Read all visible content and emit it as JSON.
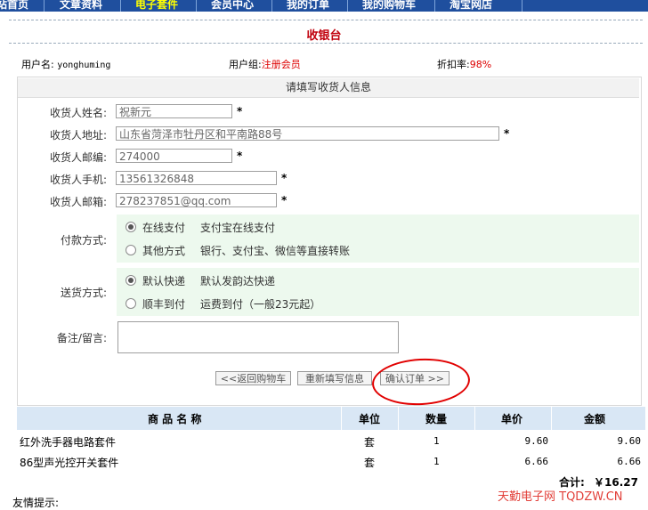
{
  "nav": {
    "items": [
      {
        "label": "站首页",
        "active": false
      },
      {
        "label": "文章资料",
        "active": false
      },
      {
        "label": "电子套件",
        "active": true
      },
      {
        "label": "会员中心",
        "active": false
      },
      {
        "label": "我的订单",
        "active": false
      },
      {
        "label": "我的购物车",
        "active": false
      },
      {
        "label": "淘宝网店",
        "active": false
      }
    ]
  },
  "page_title": "收银台",
  "user_info": {
    "username_label": "用户名:",
    "username": "yonghuming",
    "group_label": "用户组:",
    "group": "注册会员",
    "discount_label": "折扣率:",
    "discount": "98%"
  },
  "form": {
    "heading": "请填写收货人信息",
    "required_mark": "*",
    "name": {
      "label": "收货人姓名:",
      "value": "祝新元"
    },
    "address": {
      "label": "收货人地址:",
      "value": "山东省菏泽市牡丹区和平南路88号"
    },
    "zip": {
      "label": "收货人邮编:",
      "value": "274000"
    },
    "phone": {
      "label": "收货人手机:",
      "value": "13561326848"
    },
    "email": {
      "label": "收货人邮箱:",
      "value": "278237851@qq.com"
    },
    "payment": {
      "label": "付款方式:",
      "options": [
        {
          "name": "在线支付",
          "desc": "支付宝在线支付",
          "selected": true
        },
        {
          "name": "其他方式",
          "desc": "银行、支付宝、微信等直接转账",
          "selected": false
        }
      ]
    },
    "shipping": {
      "label": "送货方式:",
      "options": [
        {
          "name": "默认快递",
          "desc": "默认发韵达快递",
          "selected": true
        },
        {
          "name": "顺丰到付",
          "desc": "运费到付（一般23元起）",
          "selected": false
        }
      ]
    },
    "note": {
      "label": "备注/留言:",
      "value": ""
    },
    "buttons": {
      "back": "<<返回购物车",
      "refill": "重新填写信息",
      "confirm": "确认订单 >>"
    }
  },
  "cart_table": {
    "headers": [
      "商 品 名 称",
      "单位",
      "数量",
      "单价",
      "金额"
    ],
    "rows": [
      {
        "name": "红外洗手器电路套件",
        "unit": "套",
        "qty": "1",
        "price": "9.60",
        "amount": "9.60"
      },
      {
        "name": "86型声光控开关套件",
        "unit": "套",
        "qty": "1",
        "price": "6.66",
        "amount": "6.66"
      }
    ],
    "total_label": "合计:",
    "total_value": "￥16.27"
  },
  "watermark": "天勤电子网 TQDZW.CN",
  "footer_tip": "友情提示:",
  "colors": {
    "nav_bg": "#1f4f9e",
    "accent_red": "#c0000c",
    "highlight_circle": "#e10000",
    "table_head_bg": "#d9e7f5",
    "option_bg": "#edf9ee"
  }
}
